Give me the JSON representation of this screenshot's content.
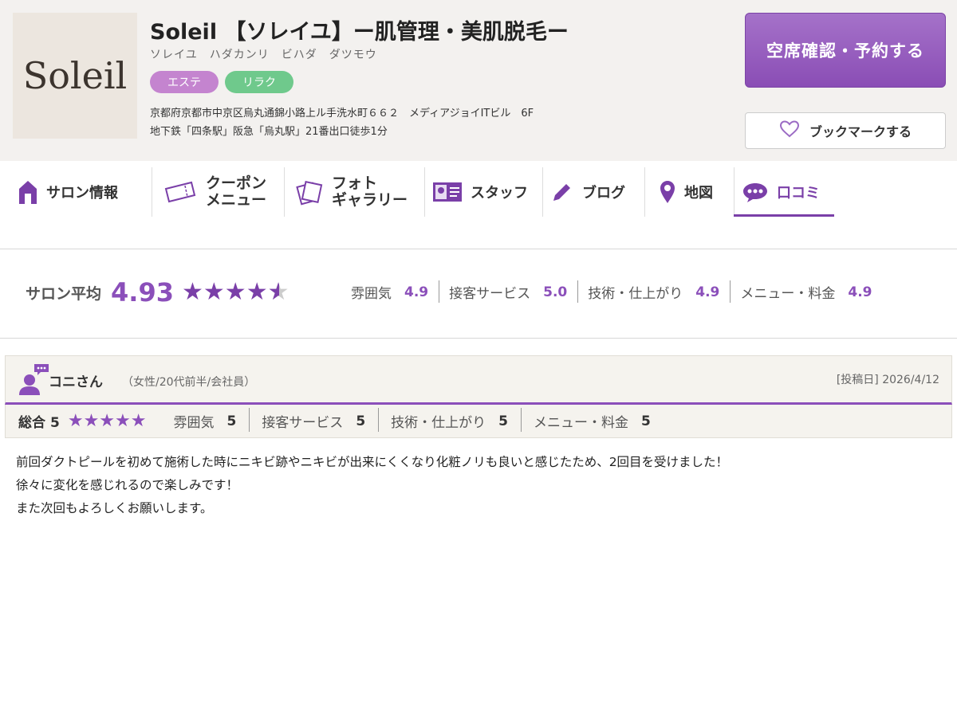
{
  "header": {
    "logo_text": "Soleil",
    "salon_name": "Soleil 【ソレイユ】ー肌管理・美肌脱毛ー",
    "salon_kana": "ソレイユ　ハダカンリ　ビハダ　ダツモウ",
    "tags": [
      "エステ",
      "リラク"
    ],
    "address": "京都府京都市中京区烏丸通錦小路上ル手洗水町６６２　メディアジョイITビル　6F",
    "access": "地下鉄「四条駅」阪急「烏丸駅」21番出口徒歩1分",
    "reserve_label": "空席確認・予約する",
    "bookmark_label": "ブックマークする"
  },
  "tabs": [
    {
      "label": "サロン情報",
      "icon": "home-icon",
      "active": false
    },
    {
      "line1": "クーポン",
      "line2": "メニュー",
      "icon": "coupon-icon",
      "active": false
    },
    {
      "line1": "フォト",
      "line2": "ギャラリー",
      "icon": "photo-icon",
      "active": false
    },
    {
      "label": "スタッフ",
      "icon": "staff-card-icon",
      "active": false
    },
    {
      "label": "ブログ",
      "icon": "pencil-icon",
      "active": false
    },
    {
      "label": "地図",
      "icon": "map-pin-icon",
      "active": false
    },
    {
      "label": "口コミ",
      "icon": "speech-bubble-icon",
      "active": true
    }
  ],
  "average": {
    "label": "サロン平均",
    "score": "4.93",
    "stars": 4.93,
    "categories": [
      {
        "label": "雰囲気",
        "value": "4.9"
      },
      {
        "label": "接客サービス",
        "value": "5.0"
      },
      {
        "label": "技術・仕上がり",
        "value": "4.9"
      },
      {
        "label": "メニュー・料金",
        "value": "4.9"
      }
    ]
  },
  "review": {
    "name": "コニさん",
    "meta": "（女性/20代前半/会社員）",
    "post_date": "[投稿日] 2026/4/12",
    "total_label": "総合",
    "total_value": "5",
    "stars": "★★★★★",
    "categories": [
      {
        "label": "雰囲気",
        "value": "5"
      },
      {
        "label": "接客サービス",
        "value": "5"
      },
      {
        "label": "技術・仕上がり",
        "value": "5"
      },
      {
        "label": "メニュー・料金",
        "value": "5"
      }
    ],
    "body": [
      "前回ダクトピールを初めて施術した時にニキビ跡やニキビが出来にくくなり化粧ノリも良いと感じたため、2回目を受けました！",
      "徐々に変化を感じれるので楽しみです！",
      "また次回もよろしくお願いします。"
    ]
  },
  "colors": {
    "accent": "#8b4fba",
    "header_bg": "#f3f1ef",
    "tag_esthe": "#c484cf",
    "tag_relax": "#6fc98c"
  }
}
